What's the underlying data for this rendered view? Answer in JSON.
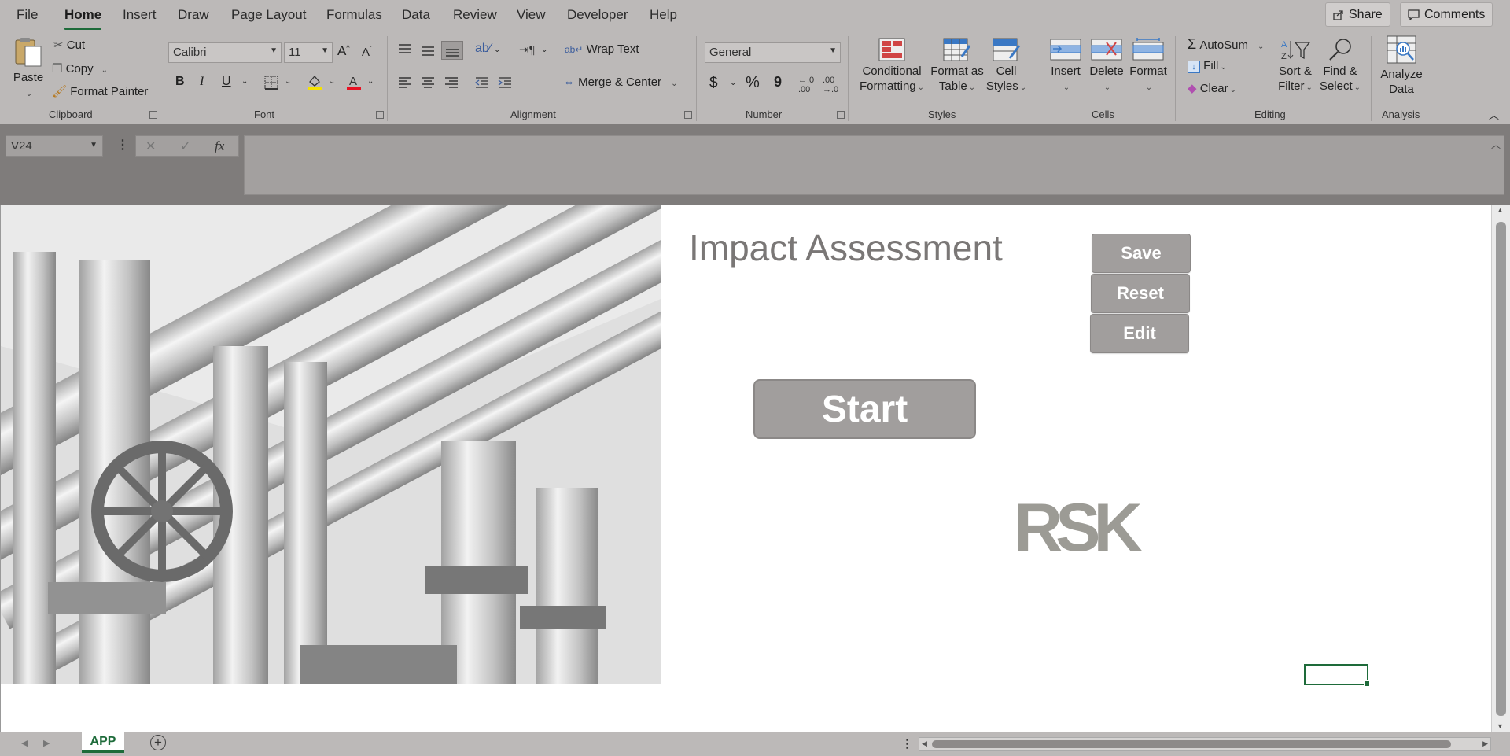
{
  "menu": {
    "tabs": [
      "File",
      "Home",
      "Insert",
      "Draw",
      "Page Layout",
      "Formulas",
      "Data",
      "Review",
      "View",
      "Developer",
      "Help"
    ],
    "active_tab": "Home",
    "share_label": "Share",
    "comments_label": "Comments"
  },
  "ribbon": {
    "clipboard": {
      "paste": "Paste",
      "cut": "Cut",
      "copy": "Copy",
      "format_painter": "Format Painter",
      "label": "Clipboard"
    },
    "font": {
      "font_name": "Calibri",
      "font_size": "11",
      "bold": "B",
      "italic": "I",
      "underline": "U",
      "label": "Font"
    },
    "alignment": {
      "wrap_text": "Wrap Text",
      "merge_center": "Merge & Center",
      "label": "Alignment"
    },
    "number": {
      "format": "General",
      "currency": "$",
      "percent": "%",
      "comma": "9",
      "label": "Number"
    },
    "styles": {
      "conditional_1": "Conditional",
      "conditional_2": "Formatting",
      "format_table_1": "Format as",
      "format_table_2": "Table",
      "cell_styles_1": "Cell",
      "cell_styles_2": "Styles",
      "label": "Styles"
    },
    "cells": {
      "insert": "Insert",
      "delete": "Delete",
      "format": "Format",
      "label": "Cells"
    },
    "editing": {
      "autosum": "AutoSum",
      "fill": "Fill",
      "clear": "Clear",
      "sort_1": "Sort &",
      "sort_2": "Filter",
      "find_1": "Find &",
      "find_2": "Select",
      "label": "Editing"
    },
    "analysis": {
      "analyze_1": "Analyze",
      "analyze_2": "Data",
      "label": "Analysis"
    }
  },
  "formula_bar": {
    "name_box": "V24",
    "cancel": "✕",
    "enter": "✓",
    "fx": "fx",
    "value": ""
  },
  "sheet": {
    "title": "Impact Assessment",
    "buttons": {
      "save": "Save",
      "reset": "Reset",
      "edit": "Edit",
      "start": "Start"
    },
    "logo_text": "RSK"
  },
  "tabs": {
    "sheet_name": "APP",
    "add": "+"
  },
  "colors": {
    "accent": "#1e6b3a",
    "button_gray": "#a19e9d",
    "logo_gray": "#9c9b95"
  }
}
